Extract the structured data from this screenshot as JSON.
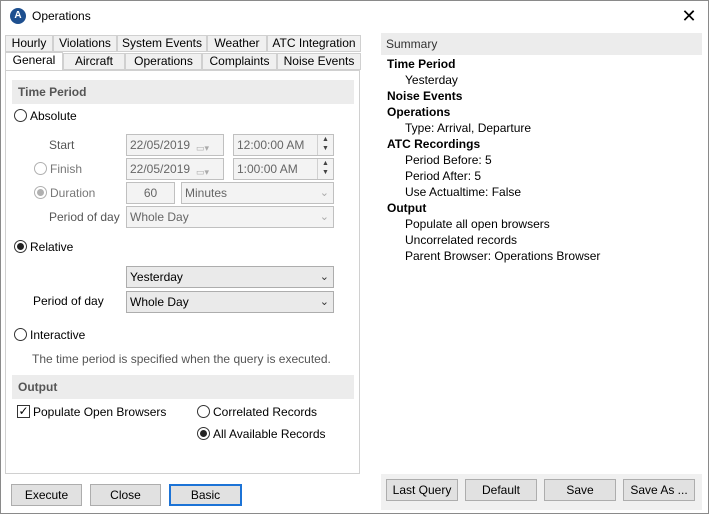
{
  "window": {
    "title": "Operations",
    "app_icon_letter": "A"
  },
  "tabs_row1": [
    "Hourly",
    "Violations",
    "System Events",
    "Weather",
    "ATC Integration"
  ],
  "tabs_row2": [
    "General",
    "Aircraft",
    "Operations",
    "Complaints",
    "Noise Events"
  ],
  "time_period": {
    "header": "Time Period",
    "absolute_label": "Absolute",
    "start_label": "Start",
    "start_date": "22/05/2019",
    "start_time": "12:00:00 AM",
    "finish_label": "Finish",
    "finish_date": "22/05/2019",
    "finish_time": "1:00:00 AM",
    "duration_label": "Duration",
    "duration_value": "60",
    "duration_unit": "Minutes",
    "abs_period_of_day_label": "Period of day",
    "abs_period_of_day_value": "Whole Day",
    "relative_label": "Relative",
    "relative_value": "Yesterday",
    "rel_period_of_day_label": "Period of day",
    "rel_period_of_day_value": "Whole Day",
    "interactive_label": "Interactive",
    "interactive_note": "The time period is specified when the query is executed."
  },
  "output": {
    "header": "Output",
    "populate_label": "Populate Open Browsers",
    "correlated_label": "Correlated Records",
    "all_available_label": "All Available Records"
  },
  "left_buttons": {
    "execute": "Execute",
    "close": "Close",
    "basic": "Basic"
  },
  "summary": {
    "header": "Summary",
    "lines": [
      {
        "text": "Time Period",
        "kind": "bold"
      },
      {
        "text": "Yesterday",
        "kind": "item"
      },
      {
        "text": "Noise Events",
        "kind": "bold"
      },
      {
        "text": "Operations",
        "kind": "bold"
      },
      {
        "text": "Type: Arrival, Departure",
        "kind": "item"
      },
      {
        "text": "ATC Recordings",
        "kind": "bold"
      },
      {
        "text": "Period Before:  5",
        "kind": "item"
      },
      {
        "text": "Period After:  5",
        "kind": "item"
      },
      {
        "text": "Use Actualtime:  False",
        "kind": "item"
      },
      {
        "text": "Output",
        "kind": "bold"
      },
      {
        "text": "Populate all open browsers",
        "kind": "item"
      },
      {
        "text": "Uncorrelated records",
        "kind": "item"
      },
      {
        "text": "Parent Browser: Operations Browser",
        "kind": "item"
      }
    ]
  },
  "right_buttons": {
    "last_query": "Last Query",
    "default": "Default",
    "save": "Save",
    "save_as": "Save As ..."
  }
}
